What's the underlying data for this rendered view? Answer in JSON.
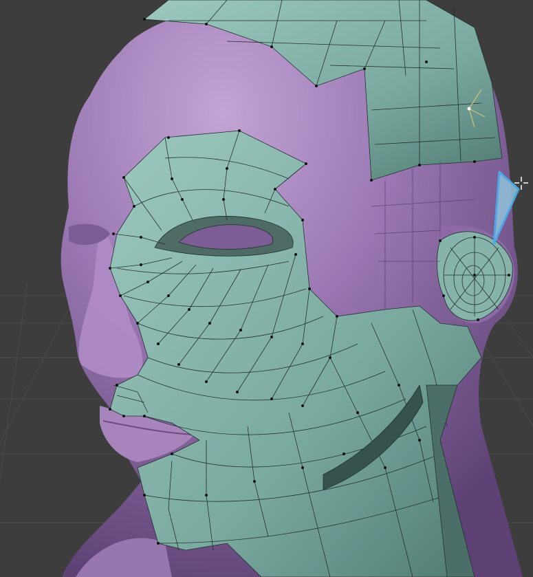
{
  "viewport": {
    "background_color": "#3d3d3d",
    "grid_color": "#4a4a4a",
    "base_mesh_color": "#9a77b2",
    "base_mesh_shadow": "#6e4f86",
    "retopo_color": "#7aa9a0",
    "retopo_dark": "#5b8a80",
    "wire_color": "#20302c",
    "vertex_color": "#111111",
    "selection_color": "#4aaef0",
    "selected_face_fill": "#8fbdd6"
  },
  "cursor": {
    "icon": "crosshair-icon"
  },
  "gizmo": {
    "icon": "transform-gizmo-icon"
  }
}
